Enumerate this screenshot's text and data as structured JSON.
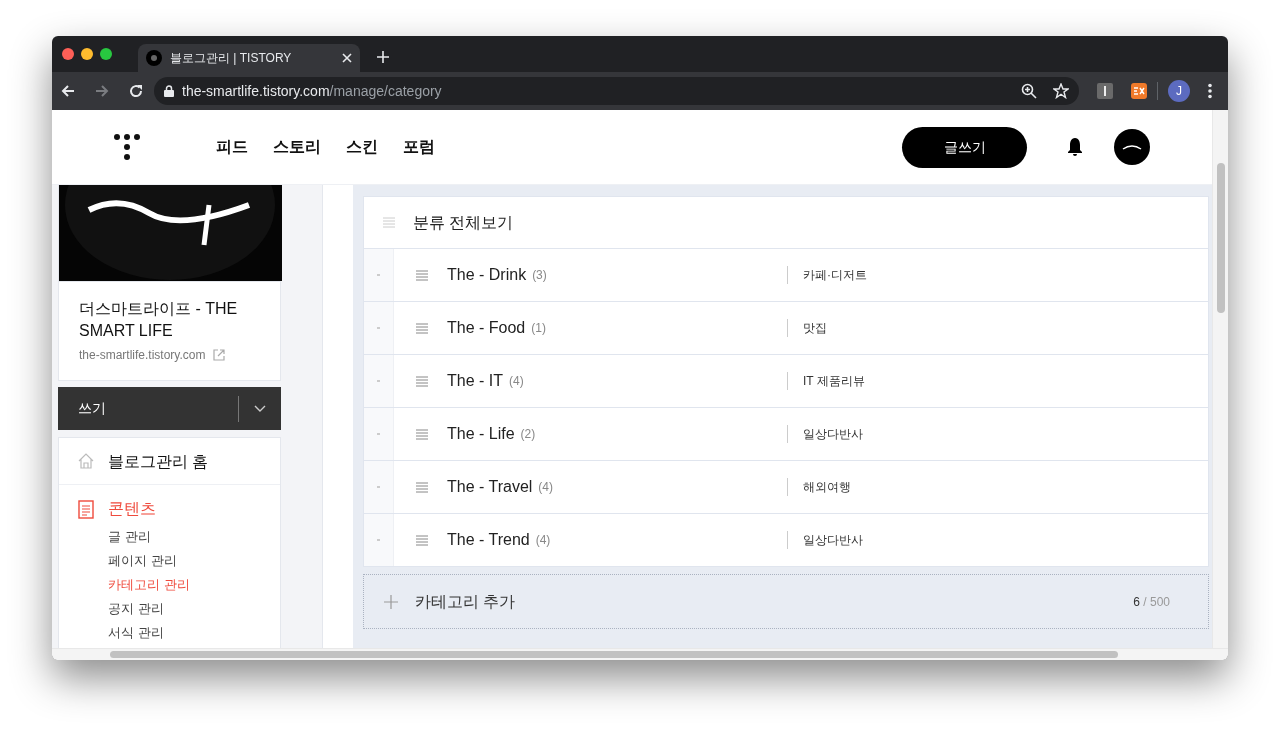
{
  "browser": {
    "tab_title": "블로그관리 | TISTORY",
    "url_host": "the-smartlife.tistory.com",
    "url_path": "/manage/category",
    "profile_initial": "J"
  },
  "header": {
    "nav": [
      {
        "label": "피드"
      },
      {
        "label": "스토리"
      },
      {
        "label": "스킨"
      },
      {
        "label": "포럼"
      }
    ],
    "write_button": "글쓰기"
  },
  "sidebar": {
    "blog_title": "더스마트라이프 - THE SMART LIFE",
    "blog_url": "the-smartlife.tistory.com",
    "write_menu": "쓰기",
    "menu": [
      {
        "label": "블로그관리 홈",
        "kind": "home",
        "selected": false
      },
      {
        "label": "콘텐츠",
        "kind": "document",
        "selected": true,
        "children": [
          {
            "label": "글 관리",
            "selected": false
          },
          {
            "label": "페이지 관리",
            "selected": false
          },
          {
            "label": "카테고리 관리",
            "selected": true
          },
          {
            "label": "공지 관리",
            "selected": false
          },
          {
            "label": "서식 관리",
            "selected": false
          }
        ]
      }
    ]
  },
  "categories": {
    "all_label": "분류 전체보기",
    "rows": [
      {
        "name": "The - Drink",
        "count": "(3)",
        "description": "카페·디저트"
      },
      {
        "name": "The - Food",
        "count": "(1)",
        "description": "맛집"
      },
      {
        "name": "The - IT",
        "count": "(4)",
        "description": "IT 제품리뷰"
      },
      {
        "name": "The - Life",
        "count": "(2)",
        "description": "일상다반사"
      },
      {
        "name": "The - Travel",
        "count": "(4)",
        "description": "해외여행"
      },
      {
        "name": "The - Trend",
        "count": "(4)",
        "description": "일상다반사"
      }
    ],
    "add_label": "카테고리 추가",
    "count_current": "6",
    "count_total": "/ 500"
  }
}
